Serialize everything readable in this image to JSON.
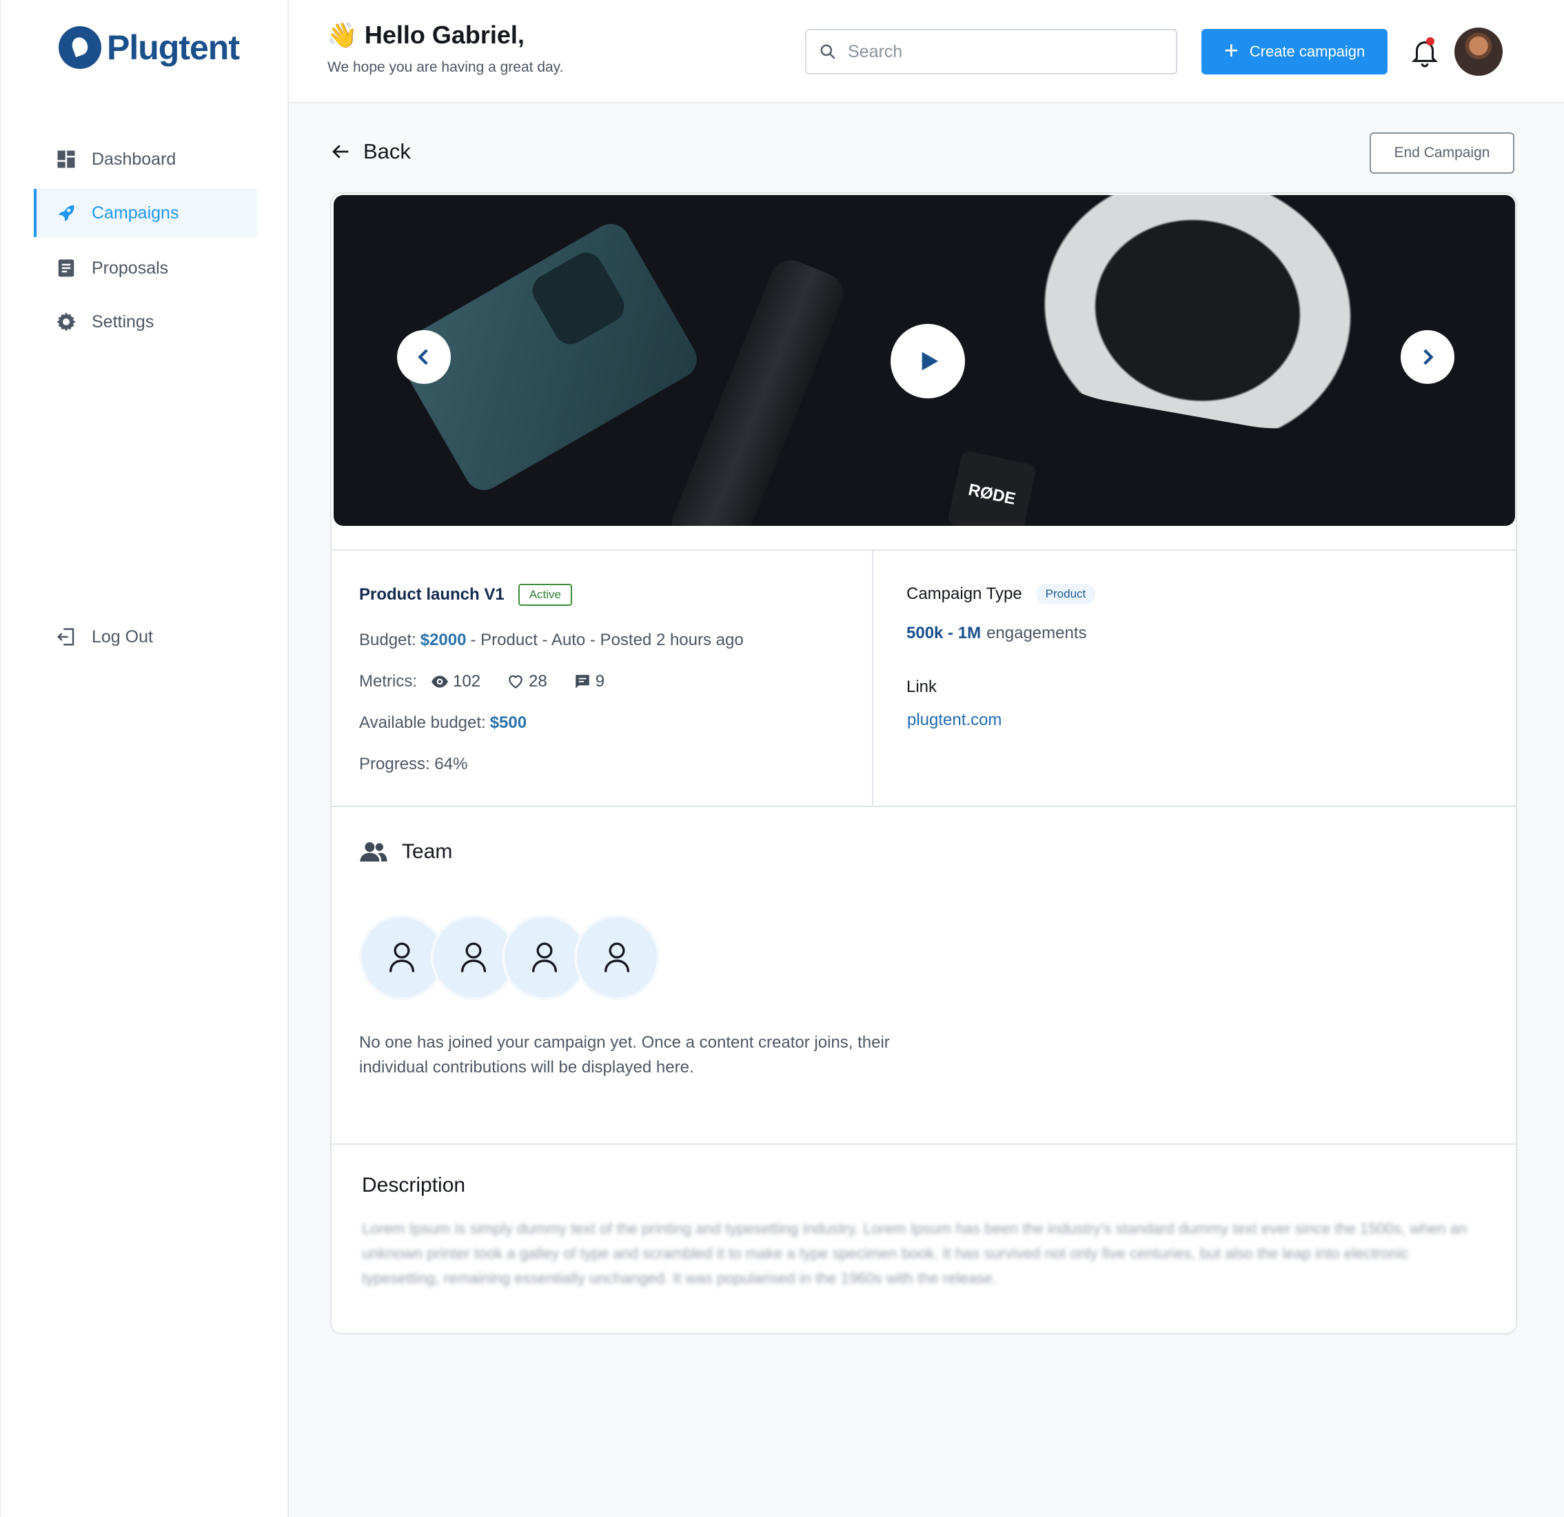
{
  "app": {
    "logo_text": "Plugtent",
    "brand_color": "#1a4f8b",
    "accent_color": "#1e8ff0"
  },
  "sidebar": {
    "items": [
      {
        "label": "Dashboard",
        "icon": "dashboard-icon",
        "active": false
      },
      {
        "label": "Campaigns",
        "icon": "rocket-icon",
        "active": true
      },
      {
        "label": "Proposals",
        "icon": "document-icon",
        "active": false
      },
      {
        "label": "Settings",
        "icon": "gear-icon",
        "active": false
      }
    ],
    "logout_label": "Log Out"
  },
  "header": {
    "greeting_emoji": "👋",
    "greeting": "Hello Gabriel,",
    "subtitle": "We hope you are having a great day.",
    "search_placeholder": "Search",
    "create_label": "Create campaign"
  },
  "page": {
    "back_label": "Back",
    "end_label": "End Campaign",
    "media": {
      "mic_brand": "RØDE"
    }
  },
  "campaign": {
    "name": "Product launch V1",
    "status": "Active",
    "budget_label": "Budget:",
    "budget": "$2000",
    "details": "- Product - Auto -  Posted 2 hours ago",
    "metrics_label": "Metrics:",
    "views": "102",
    "likes": "28",
    "comments": "9",
    "available_label": "Available budget:",
    "available": "$500",
    "progress_text": "Progress: 64%",
    "type_label": "Campaign Type",
    "type": "Product",
    "engagement_range": "500k - 1M",
    "engagement_suffix": "engagements",
    "link_label": "Link",
    "link": "plugtent.com"
  },
  "team": {
    "title": "Team",
    "message": "No one has joined your campaign yet. Once a content creator joins, their individual contributions will be displayed here."
  },
  "description": {
    "title": "Description",
    "text": "Lorem Ipsum is simply dummy text of the printing and typesetting industry. Lorem Ipsum has been the industry's standard dummy text ever since the 1500s, when an unknown printer took a galley of type and scrambled it to make a type specimen book. It has survived not only five centuries, but also the leap into electronic typesetting, remaining essentially unchanged. It was popularised in the 1960s with the release."
  }
}
